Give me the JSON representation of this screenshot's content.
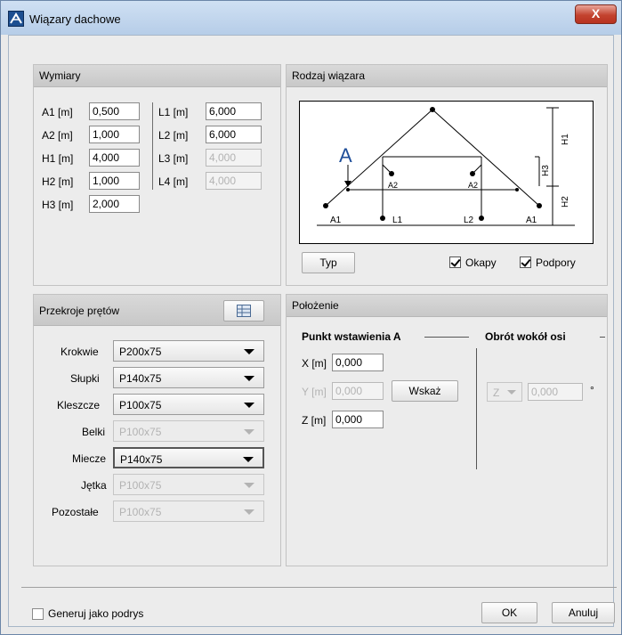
{
  "window": {
    "title": "Wiązary dachowe",
    "close_label": "X"
  },
  "wymiary": {
    "title": "Wymiary",
    "left": [
      {
        "label": "A1 [m]",
        "value": "0,500",
        "enabled": true
      },
      {
        "label": "A2 [m]",
        "value": "1,000",
        "enabled": true
      },
      {
        "label": "H1 [m]",
        "value": "4,000",
        "enabled": true
      },
      {
        "label": "H2 [m]",
        "value": "1,000",
        "enabled": true
      },
      {
        "label": "H3 [m]",
        "value": "2,000",
        "enabled": true
      }
    ],
    "right": [
      {
        "label": "L1 [m]",
        "value": "6,000",
        "enabled": true
      },
      {
        "label": "L2 [m]",
        "value": "6,000",
        "enabled": true
      },
      {
        "label": "L3 [m]",
        "value": "4,000",
        "enabled": false
      },
      {
        "label": "L4 [m]",
        "value": "4,000",
        "enabled": false
      }
    ]
  },
  "rodzaj": {
    "title": "Rodzaj wiązara",
    "diagram_labels": {
      "a": "A",
      "h1": "H1",
      "h2": "H2",
      "h3": "H3",
      "a2": "A2",
      "a1": "A1",
      "l1": "L1",
      "l2": "L2"
    },
    "typ_button": "Typ",
    "okapy": {
      "label": "Okapy",
      "checked": true
    },
    "podpory": {
      "label": "Podpory",
      "checked": true
    }
  },
  "przekroje": {
    "title": "Przekroje prętów",
    "rows": [
      {
        "label": "Krokwie",
        "value": "P200x75",
        "enabled": true
      },
      {
        "label": "Słupki",
        "value": "P140x75",
        "enabled": true
      },
      {
        "label": "Kleszcze",
        "value": "P100x75",
        "enabled": true
      },
      {
        "label": "Belki",
        "value": "P100x75",
        "enabled": false
      },
      {
        "label": "Miecze",
        "value": "P140x75",
        "enabled": true
      },
      {
        "label": "Jętka",
        "value": "P100x75",
        "enabled": false
      },
      {
        "label": "Pozostałe",
        "value": "P100x75",
        "enabled": false
      }
    ]
  },
  "polozenie": {
    "title": "Położenie",
    "punkt_title": "Punkt wstawienia A",
    "obrot_title": "Obrót wokół osi",
    "x": {
      "label": "X [m]",
      "value": "0,000"
    },
    "y": {
      "label": "Y [m]",
      "value": "0,000"
    },
    "z": {
      "label": "Z [m]",
      "value": "0,000"
    },
    "wskaz_button": "Wskaż",
    "axis": "Z",
    "angle": "0,000",
    "degree": "°"
  },
  "footer": {
    "generuj": {
      "label": "Generuj jako podrys",
      "checked": false
    },
    "ok": "OK",
    "anuluj": "Anuluj"
  }
}
